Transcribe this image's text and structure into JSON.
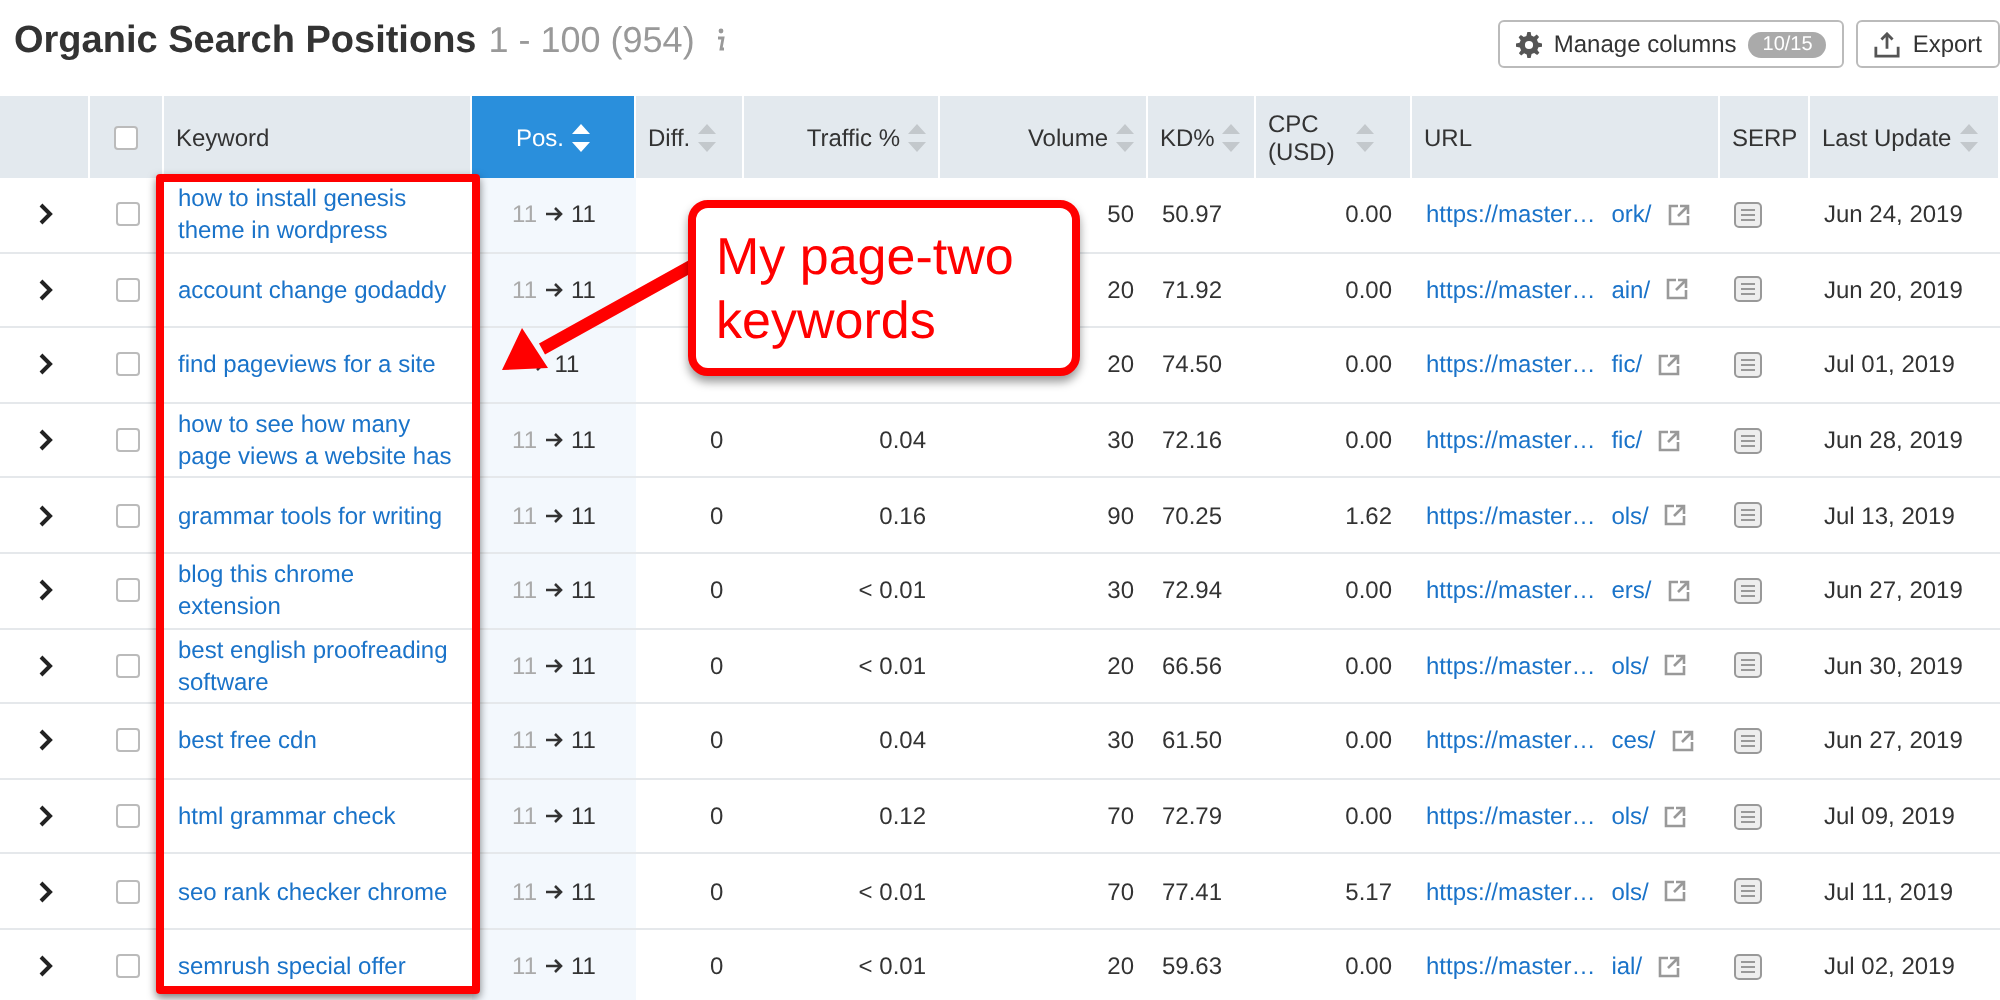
{
  "header": {
    "title": "Organic Search Positions",
    "range": "1 - 100 (954)",
    "manage_button": {
      "label": "Manage columns",
      "badge": "10/15"
    },
    "export_button": {
      "label": "Export"
    }
  },
  "table": {
    "select_all": {
      "checked": false
    },
    "columns": [
      {
        "label": "Keyword",
        "sortable": false,
        "selected": false
      },
      {
        "label": "Pos.",
        "sortable": true,
        "selected": true
      },
      {
        "label": "Diff.",
        "sortable": true,
        "selected": false
      },
      {
        "label": "Traffic %",
        "sortable": true,
        "selected": false
      },
      {
        "label": "Volume",
        "sortable": true,
        "selected": false
      },
      {
        "label": "KD%",
        "sortable": true,
        "selected": false
      },
      {
        "label": "CPC (USD)",
        "sortable": true,
        "selected": false
      },
      {
        "label": "URL",
        "sortable": false,
        "selected": false
      },
      {
        "label": "SERP",
        "sortable": false,
        "selected": false
      },
      {
        "label": "Last Update",
        "sortable": true,
        "selected": false
      }
    ],
    "rows": [
      {
        "checked": false,
        "keyword": "how to install genesis theme in wordpress",
        "pos_from": "11",
        "pos_to": "11",
        "volume": "50",
        "kd": "50.97",
        "cpc": "0.00",
        "url": "https://master…",
        "url_end": "ork/",
        "date": "Jun 24, 2019"
      },
      {
        "checked": false,
        "keyword": "account change godaddy",
        "pos_from": "11",
        "pos_to": "11",
        "volume": "20",
        "kd": "71.92",
        "cpc": "0.00",
        "url": "https://master…",
        "url_end": "ain/",
        "date": "Jun 20, 2019"
      },
      {
        "checked": false,
        "keyword": "find pageviews for a site",
        "pos_to": "11",
        "volume": "20",
        "kd": "74.50",
        "cpc": "0.00",
        "url": "https://master…",
        "url_end": "fic/",
        "date": "Jul 01, 2019"
      },
      {
        "checked": false,
        "keyword": "how to see how many page views a website has",
        "pos_from": "11",
        "pos_to": "11",
        "diff": "0",
        "traffic": "0.04",
        "volume": "30",
        "kd": "72.16",
        "cpc": "0.00",
        "url": "https://master…",
        "url_end": "fic/",
        "date": "Jun 28, 2019"
      },
      {
        "checked": false,
        "keyword": "grammar tools for writing",
        "pos_from": "11",
        "pos_to": "11",
        "diff": "0",
        "traffic": "0.16",
        "volume": "90",
        "kd": "70.25",
        "cpc": "1.62",
        "url": "https://master…",
        "url_end": "ols/",
        "date": "Jul 13, 2019"
      },
      {
        "checked": false,
        "keyword": "blog this chrome extension",
        "pos_from": "11",
        "pos_to": "11",
        "diff": "0",
        "traffic": "< 0.01",
        "volume": "30",
        "kd": "72.94",
        "cpc": "0.00",
        "url": "https://master…",
        "url_end": "ers/",
        "date": "Jun 27, 2019"
      },
      {
        "checked": false,
        "keyword": "best english proofreading software",
        "pos_from": "11",
        "pos_to": "11",
        "diff": "0",
        "traffic": "< 0.01",
        "volume": "20",
        "kd": "66.56",
        "cpc": "0.00",
        "url": "https://master…",
        "url_end": "ols/",
        "date": "Jun 30, 2019"
      },
      {
        "checked": false,
        "keyword": "best free cdn",
        "pos_from": "11",
        "pos_to": "11",
        "diff": "0",
        "traffic": "0.04",
        "volume": "30",
        "kd": "61.50",
        "cpc": "0.00",
        "url": "https://master…",
        "url_end": "ces/",
        "date": "Jun 27, 2019"
      },
      {
        "checked": false,
        "keyword": "html grammar check",
        "pos_from": "11",
        "pos_to": "11",
        "diff": "0",
        "traffic": "0.12",
        "volume": "70",
        "kd": "72.79",
        "cpc": "0.00",
        "url": "https://master…",
        "url_end": "ols/",
        "date": "Jul 09, 2019"
      },
      {
        "checked": false,
        "keyword": "seo rank checker chrome",
        "pos_from": "11",
        "pos_to": "11",
        "diff": "0",
        "traffic": "< 0.01",
        "volume": "70",
        "kd": "77.41",
        "cpc": "5.17",
        "url": "https://master…",
        "url_end": "ols/",
        "date": "Jul 11, 2019"
      },
      {
        "checked": false,
        "keyword": "semrush special offer",
        "pos_from": "11",
        "pos_to": "11",
        "diff": "0",
        "traffic": "< 0.01",
        "volume": "20",
        "kd": "59.63",
        "cpc": "0.00",
        "url": "https://master…",
        "url_end": "ial/",
        "date": "Jul 02, 2019"
      }
    ]
  },
  "callout": {
    "text": "My page-two keywords"
  }
}
